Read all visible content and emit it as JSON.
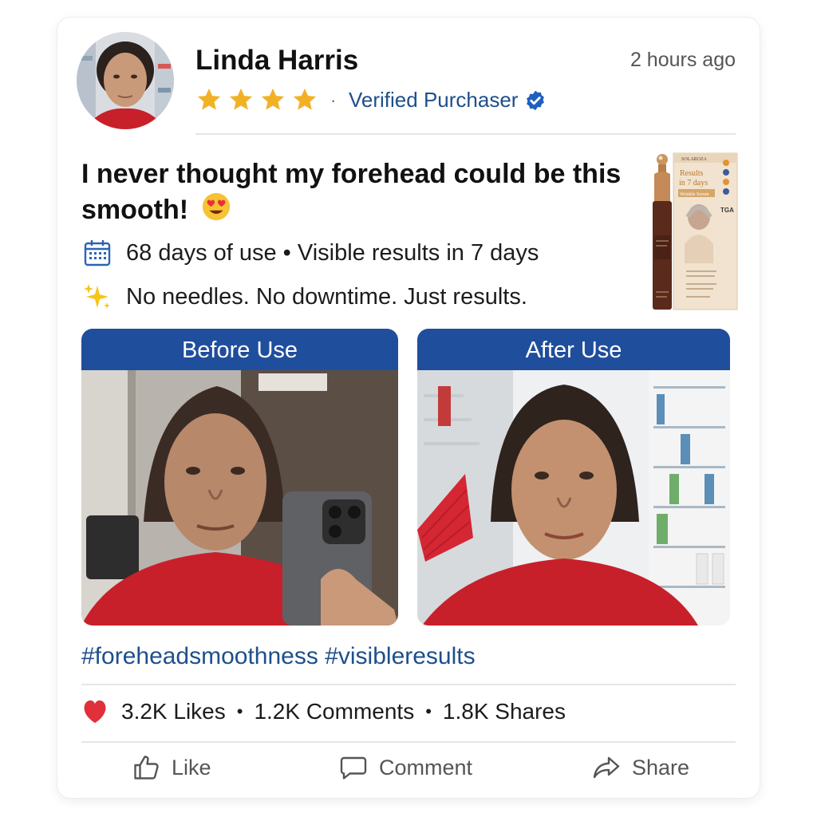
{
  "post": {
    "author": "Linda Harris",
    "rating": 4,
    "verified_label": "Verified Purchaser",
    "timestamp": "2 hours ago",
    "headline_line1": "I never thought my forehead could be this",
    "headline_line2": "smooth!",
    "features": [
      {
        "icon": "calendar-icon",
        "text": "68 days of use • Visible results in 7 days"
      },
      {
        "icon": "sparkles-icon",
        "text": "No needles. No downtime. Just results."
      }
    ],
    "product": {
      "brand": "SOLAROZA",
      "box_title_line1": "Results",
      "box_title_line2": "in 7 days",
      "box_subtitle": "Wrinkle Serum",
      "box_badge": "TGA"
    },
    "panels": {
      "before_label": "Before Use",
      "after_label": "After Use"
    },
    "hashtags": "#foreheadsmoothness #visibleresults",
    "stats": {
      "likes": "3.2K Likes",
      "comments": "1.2K Comments",
      "shares": "1.8K Shares"
    },
    "actions": {
      "like": "Like",
      "comment": "Comment",
      "share": "Share"
    }
  },
  "colors": {
    "accent": "#1f4e9c",
    "link": "#1e4f8c",
    "star": "#f2b124",
    "heart": "#e0303a",
    "shirt": "#c8202a"
  }
}
